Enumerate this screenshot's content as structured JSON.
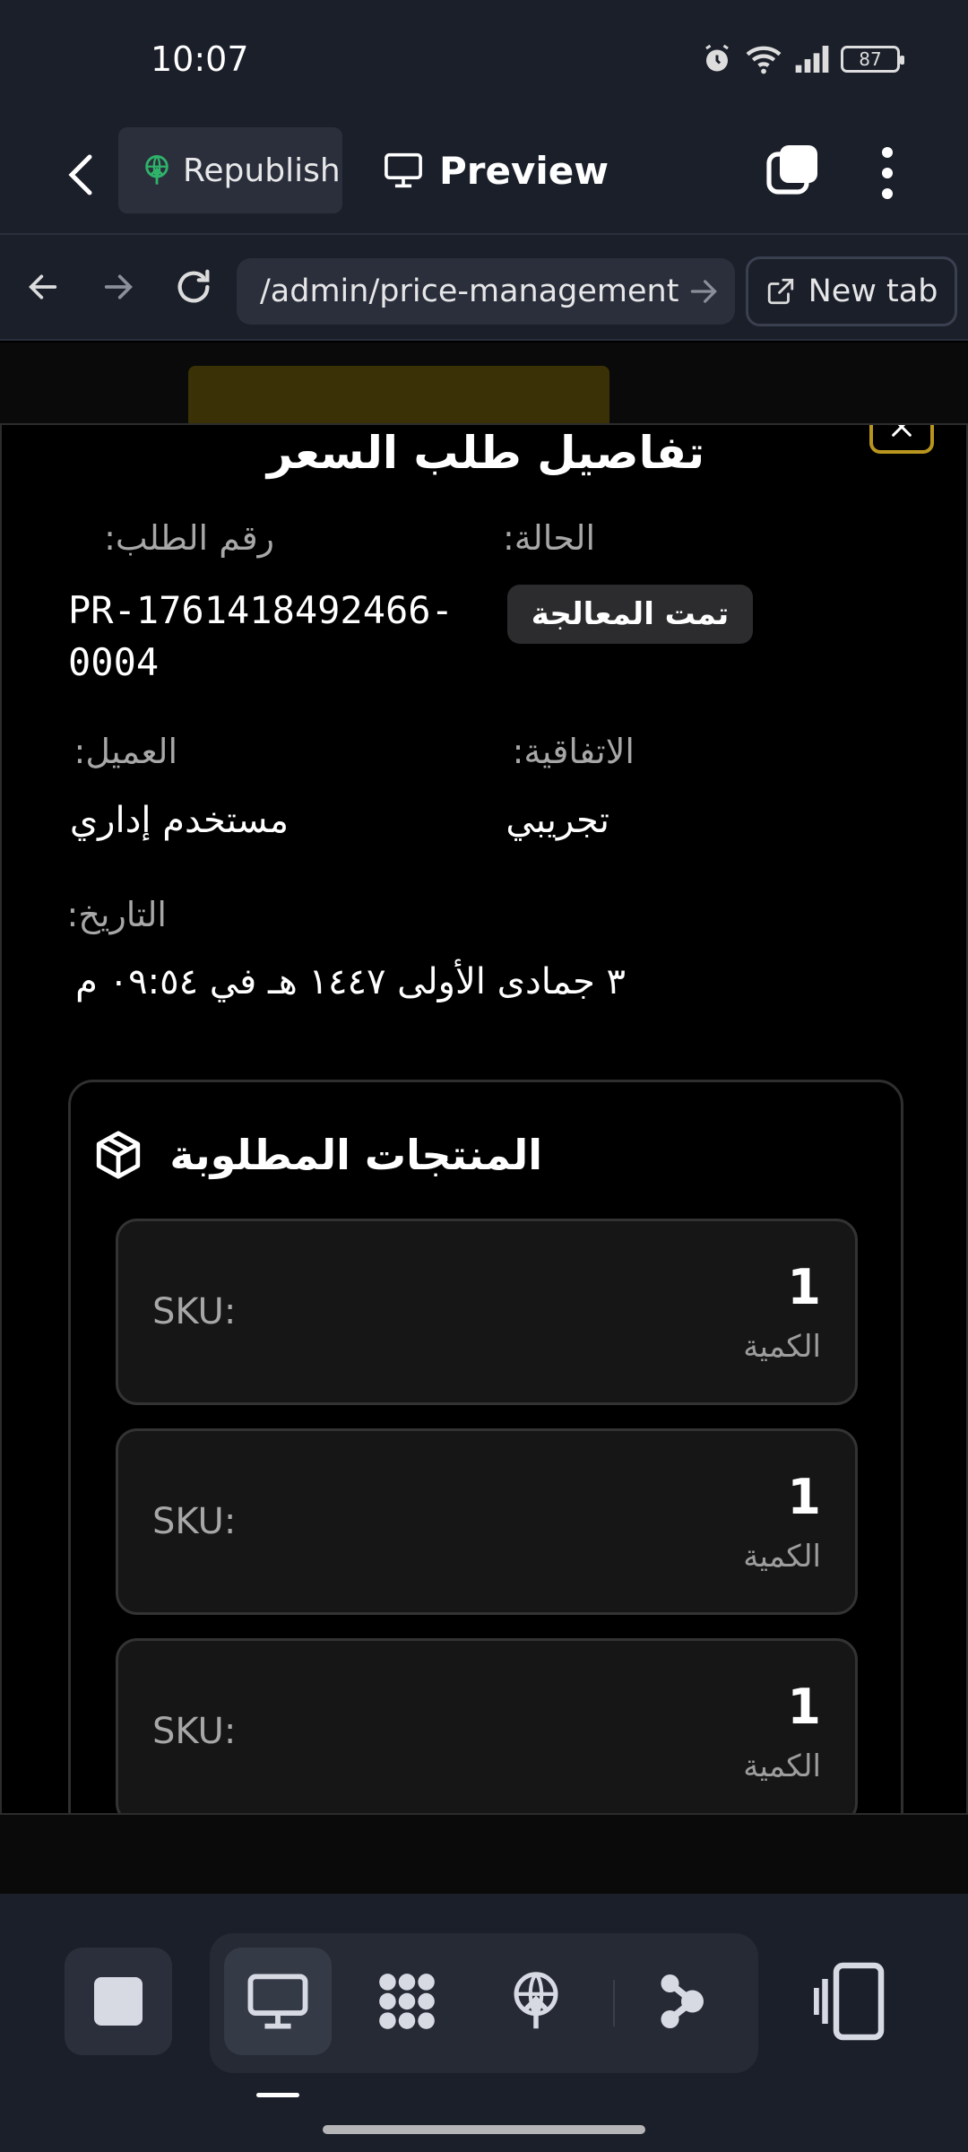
{
  "status_bar": {
    "time": "10:07",
    "battery": "87"
  },
  "toolbar": {
    "republish_label": "Republish",
    "preview_label": "Preview"
  },
  "urlbar": {
    "url": "/admin/price-management",
    "new_tab_label": "New tab"
  },
  "modal": {
    "title": "تفاصيل طلب السعر",
    "fields": {
      "request_number_label": "رقم الطلب:",
      "request_number_line1": "PR-1761418492466-",
      "request_number_line2": "0004",
      "status_label": "الحالة:",
      "status_value": "تمت المعالجة",
      "client_label": "العميل:",
      "client_value": "مستخدم إداري",
      "agreement_label": "الاتفاقية:",
      "agreement_value": "تجريبي",
      "date_label": "التاريخ:",
      "date_value": "٣ جمادى الأولى ١٤٤٧ هـ في ٠٩:٥٤ م"
    },
    "products": {
      "heading": "المنتجات المطلوبة",
      "items": [
        {
          "qty": "1",
          "qty_label": "الكمية",
          "sku": "SKU:"
        },
        {
          "qty": "1",
          "qty_label": "الكمية",
          "sku": "SKU:"
        },
        {
          "qty": "1",
          "qty_label": "الكمية",
          "sku": "SKU:"
        }
      ]
    }
  },
  "colors": {
    "accent_close": "#b8951e",
    "republish_icon": "#2fb36a",
    "bg": "#000000",
    "chrome": "#1b1f2a"
  }
}
